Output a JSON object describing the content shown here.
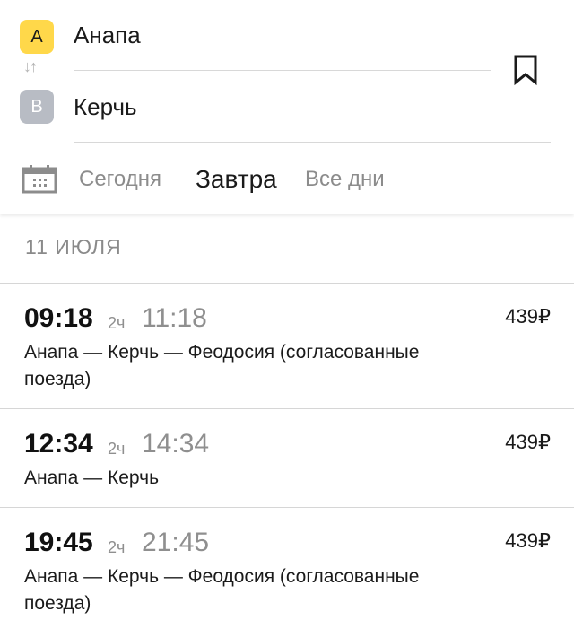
{
  "header": {
    "from_badge": "A",
    "from_city": "Анапа",
    "to_badge": "B",
    "to_city": "Керчь",
    "swap_icon": "↓↑",
    "date_tabs": [
      {
        "label": "Сегодня",
        "active": false
      },
      {
        "label": "Завтра",
        "active": true
      },
      {
        "label": "Все дни",
        "active": false
      }
    ]
  },
  "date_heading": "11 ИЮЛЯ",
  "trips": [
    {
      "departure": "09:18",
      "duration": "2ч",
      "arrival": "11:18",
      "price": "439₽",
      "route": "Анапа — Керчь — Феодосия (согласованные поезда)"
    },
    {
      "departure": "12:34",
      "duration": "2ч",
      "arrival": "14:34",
      "price": "439₽",
      "route": "Анапа — Керчь"
    },
    {
      "departure": "19:45",
      "duration": "2ч",
      "arrival": "21:45",
      "price": "439₽",
      "route": "Анапа — Керчь — Феодосия (согласованные поезда)"
    }
  ],
  "colors": {
    "badge_a": "#ffd84a",
    "badge_b": "#b8bcc4"
  }
}
